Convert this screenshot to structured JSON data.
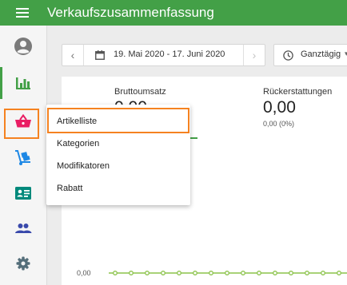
{
  "app": {
    "title": "Verkaufszusammenfassung"
  },
  "filters": {
    "date_range": "19. Mai 2020 - 17. Juni 2020",
    "time_range": "Ganztägig",
    "prev_arrow": "‹",
    "next_arrow": "›",
    "caret": "▾"
  },
  "sidebar": {
    "items": [
      {
        "name": "account",
        "icon": "account-circle-icon",
        "color": "#7a7a7a"
      },
      {
        "name": "reports",
        "icon": "bar-chart-icon",
        "color": "#43a047",
        "active": true
      },
      {
        "name": "items",
        "icon": "basket-icon",
        "color": "#e91e63",
        "highlighted": true
      },
      {
        "name": "inventory",
        "icon": "hand-truck-icon",
        "color": "#1e88e5"
      },
      {
        "name": "employees",
        "icon": "id-card-icon",
        "color": "#00897b"
      },
      {
        "name": "customers",
        "icon": "people-icon",
        "color": "#3949ab"
      },
      {
        "name": "settings",
        "icon": "gear-icon",
        "color": "#546e7a"
      }
    ]
  },
  "summary": {
    "gross": {
      "label": "Bruttoumsatz",
      "value": "0,00"
    },
    "refunds": {
      "label": "Rückerstattungen",
      "value": "0,00",
      "sub": "0,00 (0%)"
    }
  },
  "chart": {
    "y_label": "0,00"
  },
  "popup_menu": {
    "items": [
      {
        "label": "Artikelliste",
        "highlighted": true
      },
      {
        "label": "Kategorien"
      },
      {
        "label": "Modifikatoren"
      },
      {
        "label": "Rabatt"
      }
    ]
  },
  "colors": {
    "brand_green": "#43a047",
    "highlight_orange": "#f58220",
    "basket_pink": "#e91e63"
  }
}
